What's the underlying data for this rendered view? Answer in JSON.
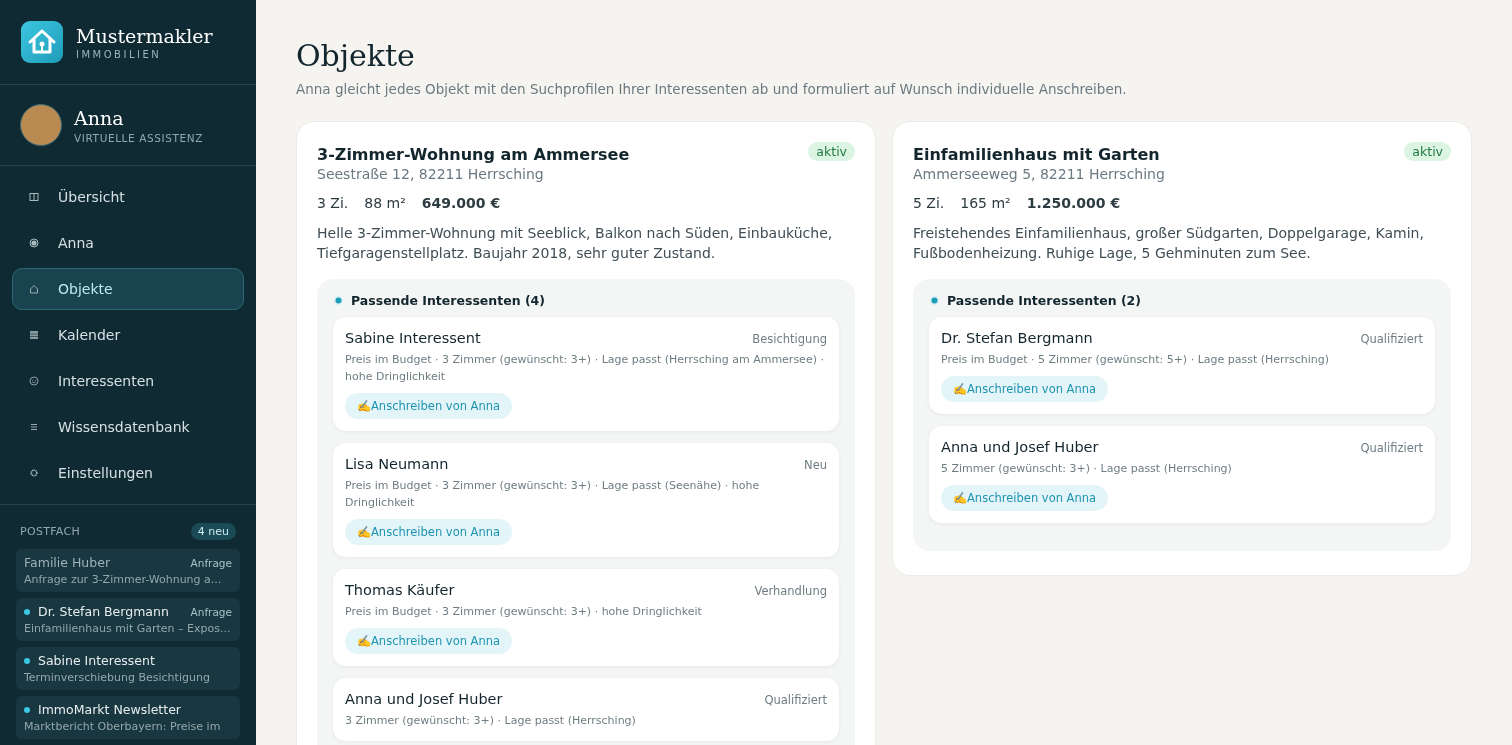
{
  "brand": {
    "name": "Mustermakler",
    "tagline": "IMMOBILIEN"
  },
  "assistant": {
    "name": "Anna",
    "role": "VIRTUELLE ASSISTENZ"
  },
  "nav": [
    {
      "kind": "overview",
      "label": "Übersicht",
      "selected": false
    },
    {
      "kind": "assistant",
      "label": "Anna",
      "selected": false
    },
    {
      "kind": "home",
      "label": "Objekte",
      "selected": true
    },
    {
      "kind": "calendar",
      "label": "Kalender",
      "selected": false
    },
    {
      "kind": "people",
      "label": "Interessenten",
      "selected": false
    },
    {
      "kind": "knowledge",
      "label": "Wissensdatenbank",
      "selected": false
    },
    {
      "kind": "settings",
      "label": "Einstellungen",
      "selected": false
    }
  ],
  "inbox": {
    "title": "POSTFACH",
    "badge": "4 neu",
    "items": [
      {
        "sender": "Familie Huber",
        "tag": "Anfrage",
        "preview": "Anfrage zur 3-Zimmer-Wohnung a...",
        "unread": false
      },
      {
        "sender": "Dr. Stefan Bergmann",
        "tag": "Anfrage",
        "preview": "Einfamilienhaus mit Garten – Expos...",
        "unread": true
      },
      {
        "sender": "Sabine Interessent",
        "preview": "Terminverschiebung Besichtigung",
        "unread": true
      },
      {
        "sender": "ImmoMarkt Newsletter",
        "preview": "Marktbericht Oberbayern: Preise im",
        "unread": true
      }
    ]
  },
  "page": {
    "title": "Objekte",
    "subtitle": "Anna gleicht jedes Objekt mit den Suchprofilen Ihrer Interessenten ab und formuliert auf Wunsch individuelle Anschreiben."
  },
  "properties": [
    {
      "title": "3-Zimmer-Wohnung am Ammersee",
      "status": "aktiv",
      "address": "Seestraße 12, 82211 Herrsching",
      "rooms": "3 Zi.",
      "area": "88 m²",
      "price": "649.000 €",
      "description": "Helle 3-Zimmer-Wohnung mit Seeblick, Balkon nach Süden, Einbauküche, Tiefgaragenstellplatz. Baujahr 2018, sehr guter Zustand.",
      "matches_title": "Passende Interessenten (4)",
      "leads": [
        {
          "name": "Sabine Interessent",
          "stage": "Besichtigung",
          "reasons": "Preis im Budget · 3 Zimmer (gewünscht: 3+) · Lage passt (Herrsching am Ammersee) · hohe Dringlichkeit",
          "action": "✍️Anschreiben von Anna"
        },
        {
          "name": "Lisa Neumann",
          "stage": "Neu",
          "reasons": "Preis im Budget · 3 Zimmer (gewünscht: 3+) · Lage passt (Seenähe) · hohe Dringlichkeit",
          "action": "✍️Anschreiben von Anna"
        },
        {
          "name": "Thomas Käufer",
          "stage": "Verhandlung",
          "reasons": "Preis im Budget · 3 Zimmer (gewünscht: 3+) · hohe Dringlichkeit",
          "action": "✍️Anschreiben von Anna"
        },
        {
          "name": "Anna und Josef Huber",
          "stage": "Qualifiziert",
          "reasons": "3 Zimmer (gewünscht: 3+) · Lage passt (Herrsching)"
        }
      ]
    },
    {
      "title": "Einfamilienhaus mit Garten",
      "status": "aktiv",
      "address": "Ammerseeweg 5, 82211 Herrsching",
      "rooms": "5 Zi.",
      "area": "165 m²",
      "price": "1.250.000 €",
      "description": "Freistehendes Einfamilienhaus, großer Südgarten, Doppelgarage, Kamin, Fußbodenheizung. Ruhige Lage, 5 Gehminuten zum See.",
      "matches_title": "Passende Interessenten (2)",
      "leads": [
        {
          "name": "Dr. Stefan Bergmann",
          "stage": "Qualifiziert",
          "reasons": "Preis im Budget · 5 Zimmer (gewünscht: 5+) · Lage passt (Herrsching)",
          "action": "✍️Anschreiben von Anna"
        },
        {
          "name": "Anna und Josef Huber",
          "stage": "Qualifiziert",
          "reasons": "5 Zimmer (gewünscht: 3+) · Lage passt (Herrsching)",
          "action": "✍️Anschreiben von Anna"
        }
      ]
    }
  ]
}
